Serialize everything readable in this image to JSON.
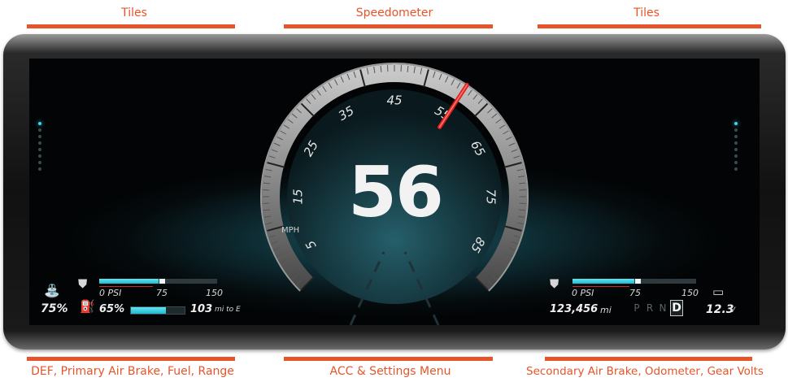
{
  "top_labels": {
    "left": "Tiles",
    "center": "Speedometer",
    "right": "Tiles"
  },
  "bottom_labels": {
    "left": "DEF, Primary Air Brake, Fuel, Range",
    "center": "ACC & Settings Menu",
    "right": "Secondary Air Brake, Odometer, Gear Volts"
  },
  "speedometer": {
    "speed": "56",
    "unit": "MPH",
    "ticks": [
      "5",
      "15",
      "25",
      "35",
      "45",
      "55",
      "65",
      "75",
      "85"
    ],
    "needle_value": 56,
    "needle_color": "#e02020"
  },
  "left_panel": {
    "def_percent": "75%",
    "air_brake_scale": [
      "0 PSI",
      "75",
      "150"
    ],
    "air_brake_level": 0.5,
    "fuel_percent": "65%",
    "fuel_level": 0.65,
    "range": "103",
    "range_unit": "mi to E"
  },
  "right_panel": {
    "air_brake_scale": [
      "0 PSI",
      "75",
      "150"
    ],
    "air_brake_level": 0.5,
    "odometer": "123,456",
    "odometer_unit": "mi",
    "gears": [
      "P",
      "R",
      "N",
      "D"
    ],
    "selected_gear": "D",
    "volts": "12.3",
    "volts_unit": "V"
  },
  "icons": {
    "def": "def-fluid-icon",
    "air_brake_primary": "air-brake-icon",
    "fuel": "fuel-pump-icon",
    "air_brake_secondary": "air-brake-icon",
    "battery": "battery-icon"
  },
  "colors": {
    "accent": "#e8542a",
    "gauge_fill": "#3fd6ea",
    "needle": "#e02020"
  }
}
